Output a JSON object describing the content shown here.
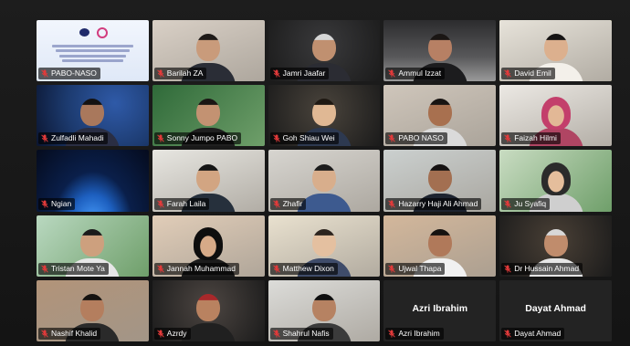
{
  "meeting": {
    "participants": [
      {
        "name": "PABO-NASO",
        "muted": true,
        "bg": "slide",
        "bg_color": "#dfe8f7",
        "person": null
      },
      {
        "name": "Barilah ZA",
        "muted": true,
        "bg": "room",
        "bg_color": "#d9d0c6",
        "person": {
          "skin": "#c99b7b",
          "shirt": "#2a2d36",
          "hair": "#1e1a18"
        }
      },
      {
        "name": "Jamri Jaafar",
        "muted": true,
        "bg": "dark",
        "bg_color": "#3a3a3c",
        "person": {
          "skin": "#c09070",
          "shirt": "#2b2c33",
          "hair": "#d6d6d6"
        }
      },
      {
        "name": "Ammul Izzat",
        "muted": true,
        "bg": "moon",
        "bg_color": "#58585a",
        "person": {
          "skin": "#b78064",
          "shirt": "#1c1c1e",
          "hair": "#1a1614"
        }
      },
      {
        "name": "David Emil",
        "muted": true,
        "bg": "room",
        "bg_color": "#e7e3da",
        "person": {
          "skin": "#dcb08e",
          "shirt": "#f3f0ea",
          "hair": "#151313"
        },
        "active": true
      },
      {
        "name": "Zulfadli Mahadi",
        "muted": true,
        "bg": "space",
        "bg_color": "#1c3a6e",
        "person": {
          "skin": "#a9785c",
          "shirt": "#2a2e43",
          "hair": "#141212"
        }
      },
      {
        "name": "Sonny Jumpo PABO",
        "muted": true,
        "bg": "green",
        "bg_color": "#2f6a39",
        "person": {
          "skin": "#c39272",
          "shirt": "#1f1f1f",
          "hair": "#1a1614"
        }
      },
      {
        "name": "Goh Shiau Wei",
        "muted": true,
        "bg": "dark",
        "bg_color": "#4a443c",
        "person": {
          "skin": "#e0b894",
          "shirt": "#2d3950",
          "hair": "#1e1812"
        }
      },
      {
        "name": "PABO NASO",
        "muted": true,
        "bg": "room",
        "bg_color": "#cfc6bb",
        "person": {
          "skin": "#a8704f",
          "shirt": "#dadada",
          "hair": "#181412"
        }
      },
      {
        "name": "Faizah Hilmi",
        "muted": true,
        "bg": "room",
        "bg_color": "#ece9e4",
        "person": {
          "skin": "#e2b896",
          "shirt": "#b04563",
          "hair": "#c33f6b"
        },
        "hijab": true
      },
      {
        "name": "Ngian",
        "muted": true,
        "bg": "earth",
        "bg_color": "#0a1f4a",
        "person": null
      },
      {
        "name": "Farah Laila",
        "muted": true,
        "bg": "room",
        "bg_color": "#e7e6e1",
        "person": {
          "skin": "#d2a582",
          "shirt": "#26303c",
          "hair": "#151515"
        }
      },
      {
        "name": "Zhafir",
        "muted": true,
        "bg": "room",
        "bg_color": "#d7d5d0",
        "person": {
          "skin": "#d8ae8c",
          "shirt": "#3d5a8f",
          "hair": "#1c1c1c"
        }
      },
      {
        "name": "Hazarry Haji Ali Ahmad",
        "muted": true,
        "bg": "room",
        "bg_color": "#cbd0cf",
        "person": {
          "skin": "#a36f51",
          "shirt": "#1e2430",
          "hair": "#151212"
        }
      },
      {
        "name": "Ju Syafiq",
        "muted": true,
        "bg": "green",
        "bg_color": "#c9dcc2",
        "person": {
          "skin": "#e5be9c",
          "shirt": "#cfcfcf",
          "hair": "#2b2b2b"
        },
        "hijab": true
      },
      {
        "name": "Tristan Mote Ya",
        "muted": true,
        "bg": "green",
        "bg_color": "#b9d8c0",
        "person": {
          "skin": "#cda07e",
          "shirt": "#e6e6e6",
          "hair": "#1b1b1b"
        }
      },
      {
        "name": "Jannah Muhammad",
        "muted": true,
        "bg": "room",
        "bg_color": "#e1cdb8",
        "person": {
          "skin": "#d6aa88",
          "shirt": "#1c1c1c",
          "hair": "#0e0e0e"
        },
        "hijab": true
      },
      {
        "name": "Matthew Dixon",
        "muted": true,
        "bg": "room",
        "bg_color": "#e9e1cf",
        "person": {
          "skin": "#e4c0a0",
          "shirt": "#3f4c6a",
          "hair": "#2c241e"
        }
      },
      {
        "name": "Ujwal Thapa",
        "muted": true,
        "bg": "room",
        "bg_color": "#d3b79b",
        "person": {
          "skin": "#b0795a",
          "shirt": "#f1f1f1",
          "hair": "#161210"
        }
      },
      {
        "name": "Dr Hussain Ahmad",
        "muted": true,
        "bg": "dark",
        "bg_color": "#4a4036",
        "person": {
          "skin": "#c08c6c",
          "shirt": "#e6e6e6",
          "hair": "#d8d8d8"
        }
      },
      {
        "name": "Nashif Khalid",
        "muted": true,
        "bg": "room",
        "bg_color": "#b29479",
        "person": {
          "skin": "#b47e5e",
          "shirt": "#2a2a2a",
          "hair": "#151210"
        }
      },
      {
        "name": "Azrdy",
        "muted": true,
        "bg": "dark",
        "bg_color": "#4d4642",
        "person": {
          "skin": "#b98260",
          "shirt": "#202020",
          "hair": "#a8282a"
        }
      },
      {
        "name": "Shahrul Nafis",
        "muted": true,
        "bg": "room",
        "bg_color": "#dcdcd9",
        "person": {
          "skin": "#b68262",
          "shirt": "#3b3b3b",
          "hair": "#0f0f0f"
        }
      },
      {
        "name": "Azri Ibrahim",
        "muted": true,
        "bg": "none",
        "bg_color": "#232323",
        "person": null,
        "camera_off": true
      },
      {
        "name": "Dayat Ahmad",
        "muted": true,
        "bg": "none",
        "bg_color": "#232323",
        "person": null,
        "camera_off": true
      }
    ]
  },
  "colors": {
    "mute_icon": "#e23a3a",
    "active_speaker": "#e9e86a",
    "window_background": "#181818"
  }
}
